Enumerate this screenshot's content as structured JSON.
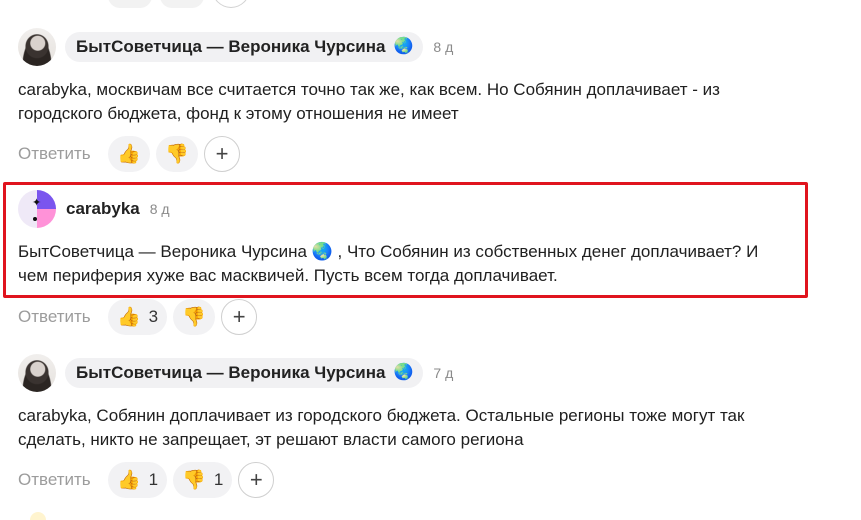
{
  "comments": [
    {
      "author": "БытСоветчица — Вероника Чурсина",
      "globe": "🌏",
      "time": "8 д",
      "text": "carabyka, москвичам все считается точно так же, как всем. Но Собянин доплачивает - из городского бюджета, фонд к этому отношения не имеет",
      "reply_label": "Ответить",
      "like": {
        "emoji": "👍",
        "count": ""
      },
      "dislike": {
        "emoji": "👎",
        "count": ""
      },
      "add": "+"
    },
    {
      "author": "carabyka",
      "time": "8 д",
      "text": "БытСоветчица — Вероника Чурсина 🌏 , Что Собянин из собственных денег доплачивает? И чем периферия хуже вас масквичей. Пусть всем тогда доплачивает.",
      "reply_label": "Ответить",
      "like": {
        "emoji": "👍",
        "count": "3"
      },
      "dislike": {
        "emoji": "👎",
        "count": ""
      },
      "add": "+"
    },
    {
      "author": "БытСоветчица — Вероника Чурсина",
      "globe": "🌏",
      "time": "7 д",
      "text": "carabyka, Собянин доплачивает из городского бюджета. Остальные регионы тоже могут так сделать, никто не запрещает, эт решают власти самого региона",
      "reply_label": "Ответить",
      "like": {
        "emoji": "👍",
        "count": "1"
      },
      "dislike": {
        "emoji": "👎",
        "count": "1"
      },
      "add": "+"
    }
  ],
  "colors": {
    "highlight": "#e0141e",
    "pill_bg": "#f1f1f3"
  }
}
